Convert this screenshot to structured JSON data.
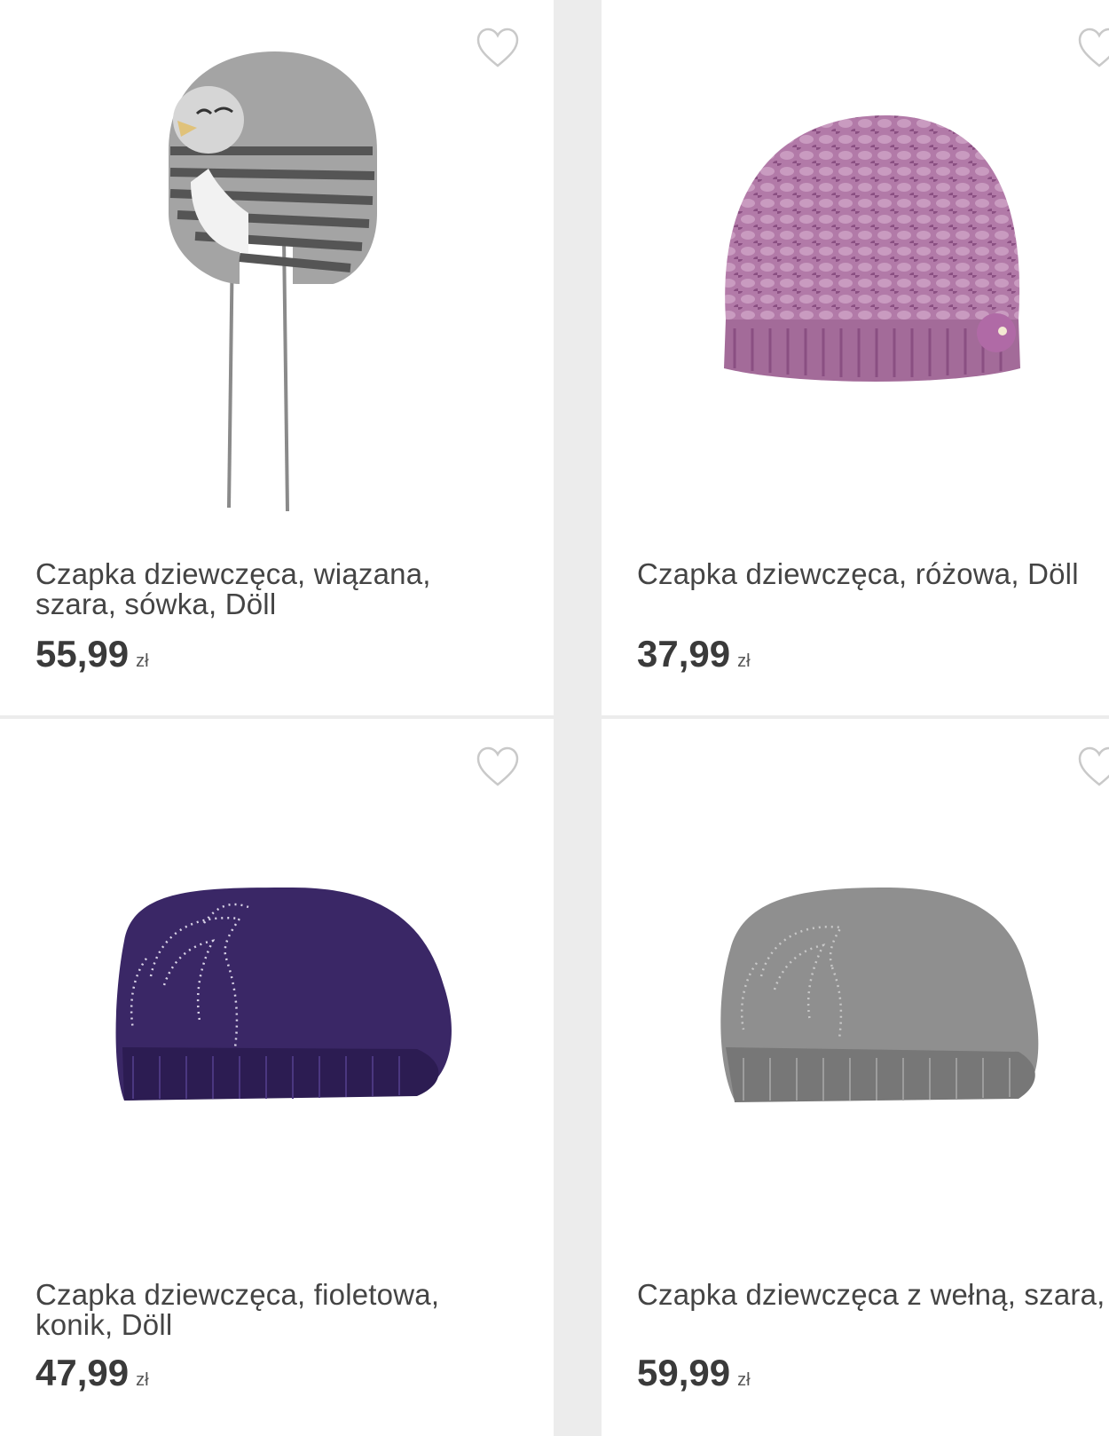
{
  "products": [
    {
      "title": "Czapka dziewczęca, wiązana, szara, sówka, Döll",
      "price": "55,99",
      "currency": "zł",
      "image_icon": "gray-striped-owl-hat-icon",
      "colors": {
        "main": "#a4a4a4",
        "stripe": "#555555"
      }
    },
    {
      "title": "Czapka dziewczęca, różowa, Döll",
      "price": "37,99",
      "currency": "zł",
      "image_icon": "pink-knit-beanie-icon",
      "colors": {
        "main": "#b27aa8",
        "dark": "#8a4f82"
      }
    },
    {
      "title": "Czapka dziewczęca, fioletowa, konik, Döll",
      "price": "47,99",
      "currency": "zł",
      "image_icon": "purple-horse-beret-icon",
      "colors": {
        "main": "#3a2766",
        "dark": "#2c1c52"
      }
    },
    {
      "title": "Czapka dziewczęca z wełną, szara, Döll",
      "price": "59,99",
      "currency": "zł",
      "image_icon": "gray-wool-beret-icon",
      "colors": {
        "main": "#8f8f8f",
        "dark": "#777777"
      }
    }
  ],
  "favorite_icon": "heart-outline-icon"
}
